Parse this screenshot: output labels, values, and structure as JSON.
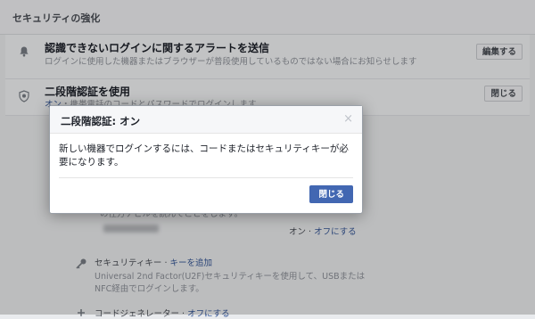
{
  "section": {
    "title": "セキュリティの強化"
  },
  "alerts_row": {
    "title": "認識できないログインに関するアラートを送信",
    "description": "ログインに使用した機器またはブラウザーが普段使用しているものではない場合にお知らせします",
    "button": "編集する"
  },
  "twofa_row": {
    "title": "二段階認証を使用",
    "status": "オン",
    "description": "・携帯電話のコードとパスワードでログインします",
    "button": "閉じる"
  },
  "background": {
    "partial_text": "の仕方ナビルを読んてことをします。",
    "device_toggle": {
      "on": "オン",
      "separator": " · ",
      "off": "オフにする"
    },
    "security_key": {
      "label": "セキュリティキー · ",
      "link": "キーを追加",
      "desc_line1": "Universal 2nd Factor(U2F)セキュリティキーを使用して、USBまたは",
      "desc_line2": "NFC経由でログインします。"
    },
    "bottom_partial": {
      "label": "コードジェネレーター · ",
      "link": "オフにする"
    }
  },
  "modal": {
    "title": "二段階認証: オン",
    "close_symbol": "×",
    "body": "新しい機器でログインするには、コードまたはセキュリティキーが必要になります。",
    "primary_button": "閉じる"
  }
}
